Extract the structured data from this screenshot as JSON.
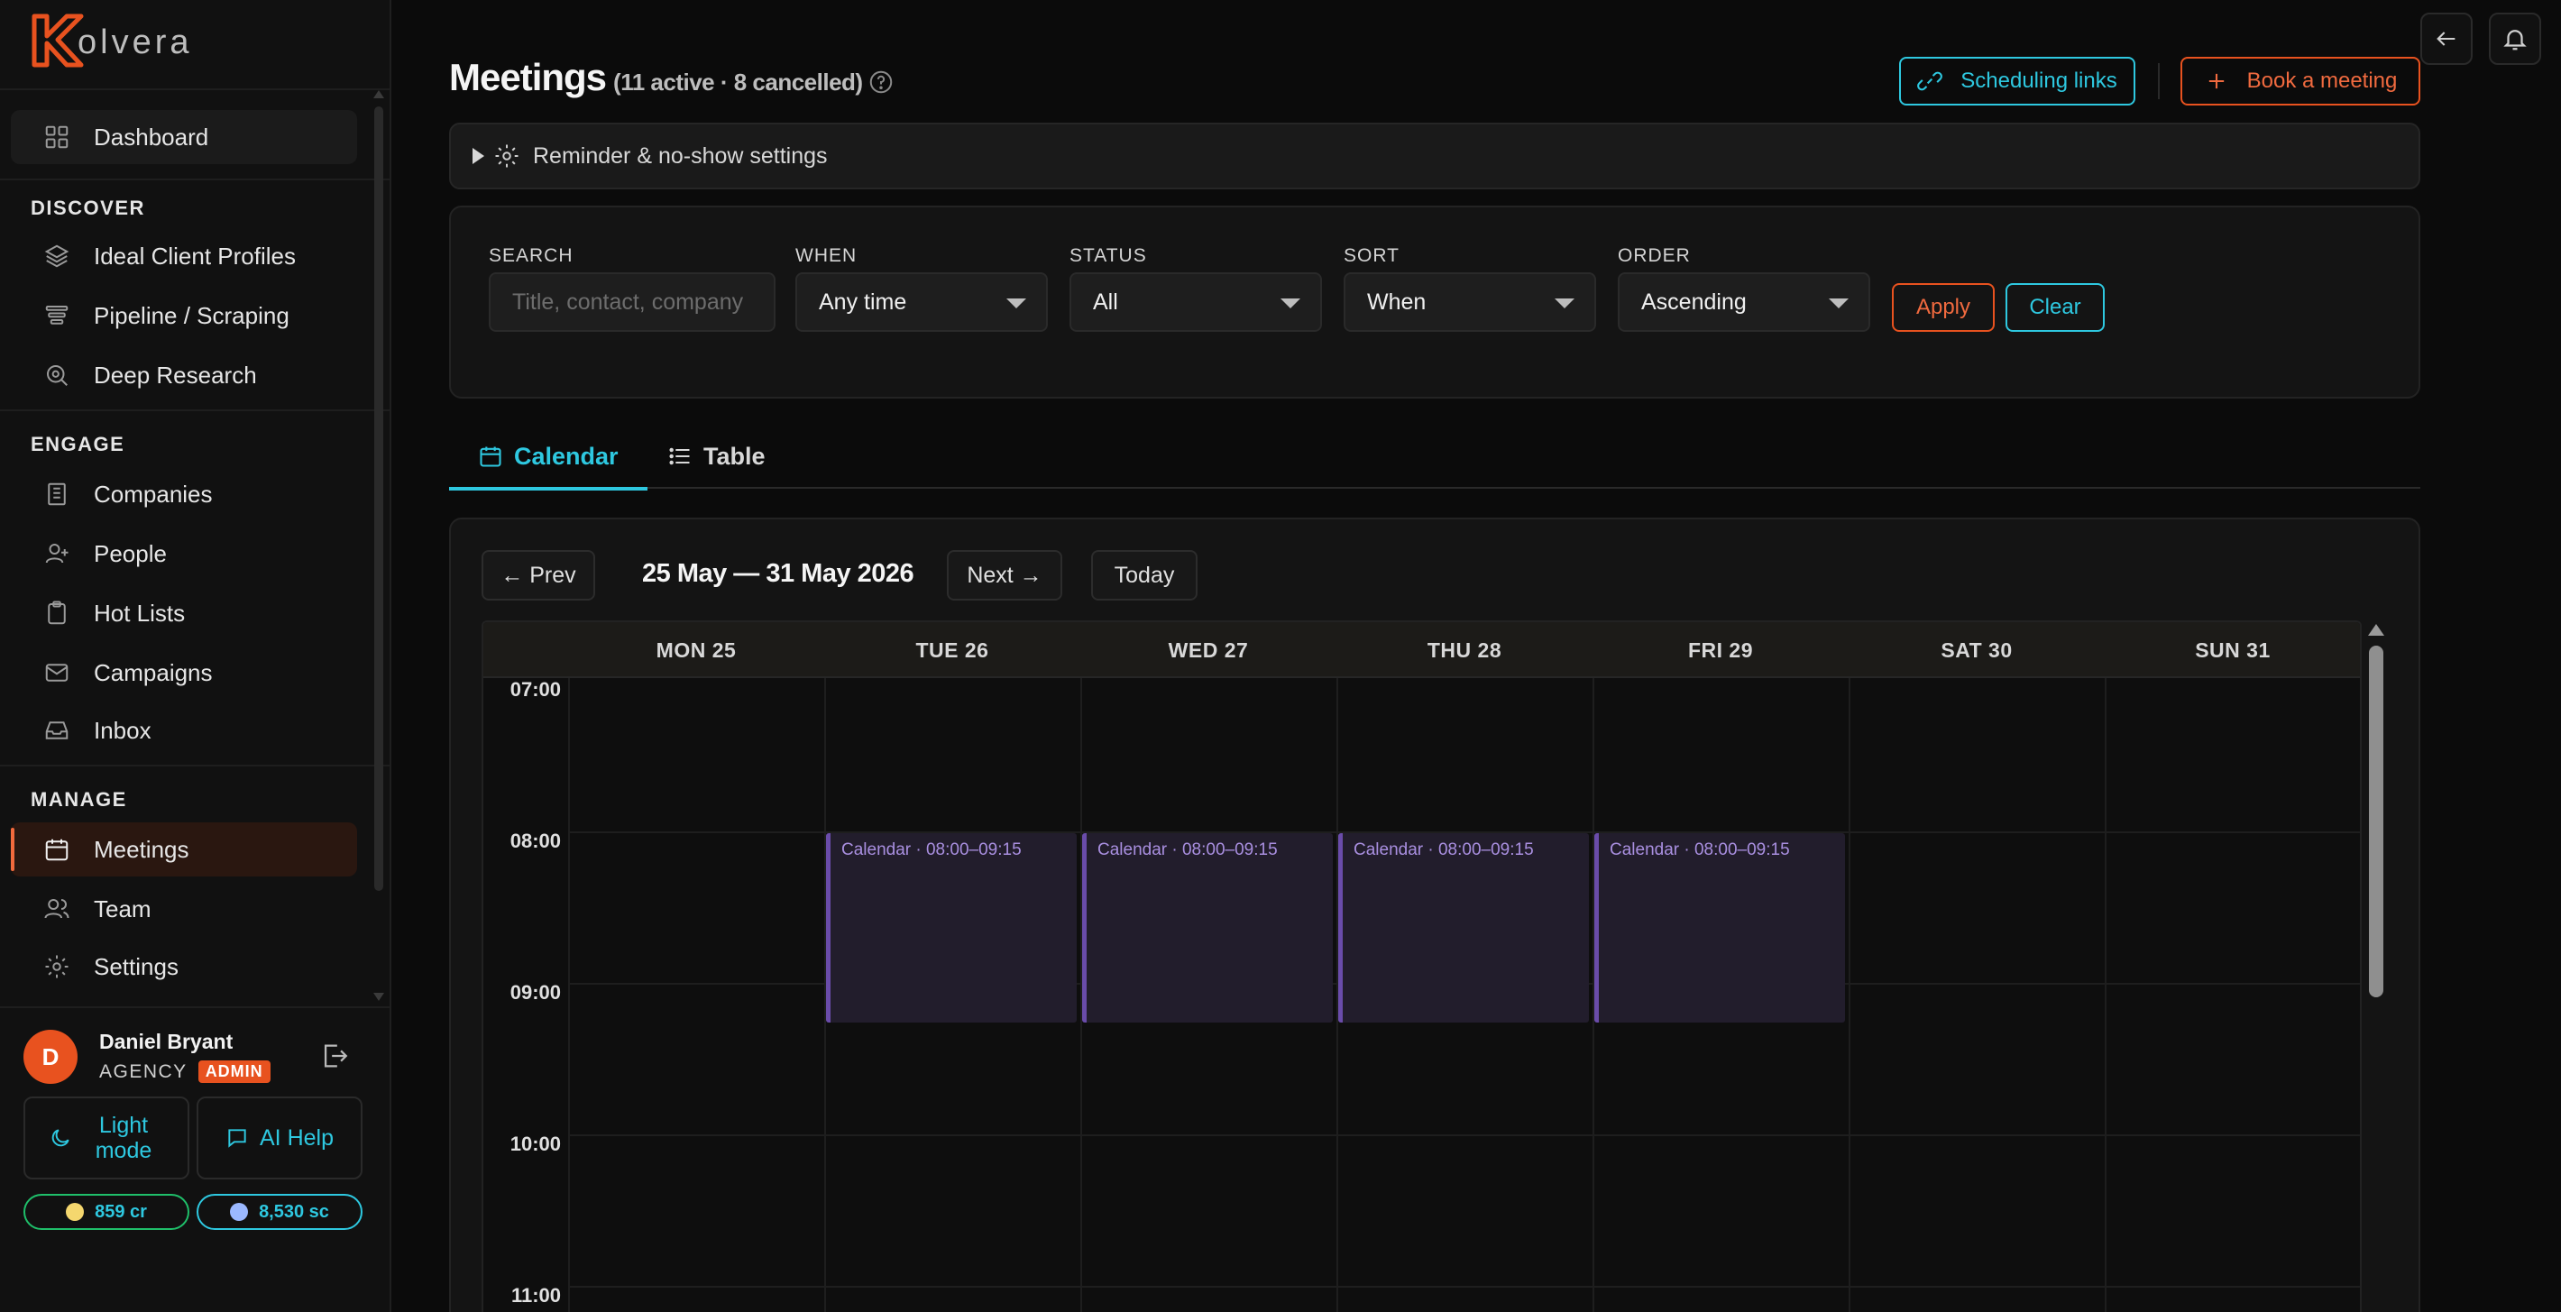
{
  "brand": {
    "logo_letter": "K",
    "logo_rest": "olvera",
    "accent": "#e8521f",
    "cyan": "#2ec8e0"
  },
  "sidebar": {
    "dashboard": "Dashboard",
    "sections": {
      "discover": "DISCOVER",
      "engage": "ENGAGE",
      "manage": "MANAGE"
    },
    "discover_items": [
      "Ideal Client Profiles",
      "Pipeline / Scraping",
      "Deep Research"
    ],
    "engage_items": [
      "Companies",
      "People",
      "Hot Lists",
      "Campaigns",
      "Inbox"
    ],
    "manage_items": [
      "Meetings",
      "Team",
      "Settings"
    ],
    "active_item": "Meetings",
    "user": {
      "initial": "D",
      "name": "Daniel Bryant",
      "role": "AGENCY",
      "badge": "ADMIN"
    },
    "light_mode": "Light mode",
    "ai_help": "AI Help",
    "credits": "859 cr",
    "sc": "8,530 sc"
  },
  "header": {
    "title": "Meetings",
    "subtitle": "(11 active · 8 cancelled)",
    "scheduling_links": "Scheduling links",
    "book_meeting": "Book a meeting"
  },
  "reminder": {
    "label": "Reminder & no-show settings"
  },
  "filters": {
    "search_label": "SEARCH",
    "search_placeholder": "Title, contact, company",
    "when_label": "WHEN",
    "when_value": "Any time",
    "status_label": "STATUS",
    "status_value": "All",
    "sort_label": "SORT",
    "sort_value": "When",
    "order_label": "ORDER",
    "order_value": "Ascending",
    "apply": "Apply",
    "clear": "Clear"
  },
  "tabs": {
    "calendar": "Calendar",
    "table": "Table",
    "active": "Calendar"
  },
  "calendar": {
    "prev": "← Prev",
    "next": "Next →",
    "today": "Today",
    "range": "25 May — 31 May 2026",
    "days": [
      "MON 25",
      "TUE 26",
      "WED 27",
      "THU 28",
      "FRI 29",
      "SAT 30",
      "SUN 31"
    ],
    "hours": [
      "07:00",
      "08:00",
      "09:00",
      "10:00",
      "11:00"
    ],
    "events": [
      {
        "day": "TUE 26",
        "label": "Calendar · 08:00–09:15"
      },
      {
        "day": "WED 27",
        "label": "Calendar · 08:00–09:15"
      },
      {
        "day": "THU 28",
        "label": "Calendar · 08:00–09:15"
      },
      {
        "day": "FRI 29",
        "label": "Calendar · 08:00–09:15"
      }
    ]
  }
}
